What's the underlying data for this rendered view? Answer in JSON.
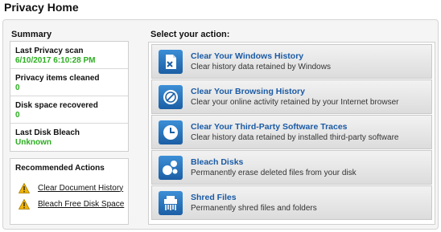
{
  "page": {
    "title": "Privacy Home"
  },
  "summary": {
    "heading": "Summary",
    "items": [
      {
        "label": "Last Privacy scan",
        "value": "6/10/2017 6:10:28 PM"
      },
      {
        "label": "Privacy items cleaned",
        "value": "0"
      },
      {
        "label": "Disk space recovered",
        "value": "0"
      },
      {
        "label": "Last Disk Bleach",
        "value": "Unknown"
      }
    ]
  },
  "recommended": {
    "heading": "Recommended Actions",
    "items": [
      {
        "label": "Clear Document History",
        "icon": "warning-icon"
      },
      {
        "label": "Bleach Free Disk Space",
        "icon": "warning-icon"
      }
    ]
  },
  "actions": {
    "heading": "Select your action:",
    "items": [
      {
        "title": "Clear Your Windows History",
        "desc": "Clear history data retained by Windows",
        "icon": "windows-history-icon"
      },
      {
        "title": "Clear Your Browsing History",
        "desc": "Clear your online activity retained by your Internet browser",
        "icon": "browser-icon"
      },
      {
        "title": "Clear Your Third-Party Software Traces",
        "desc": "Clear history data retained by installed third-party software",
        "icon": "clock-icon"
      },
      {
        "title": "Bleach Disks",
        "desc": "Permanently erase deleted files from your disk",
        "icon": "bubbles-icon"
      },
      {
        "title": "Shred Files",
        "desc": "Permanently shred files and folders",
        "icon": "shredder-icon"
      }
    ]
  },
  "colors": {
    "accent": "#1a5aa5",
    "success": "#2cae21",
    "icon_blue": "#2a77c2",
    "warning": "#f0b400"
  }
}
